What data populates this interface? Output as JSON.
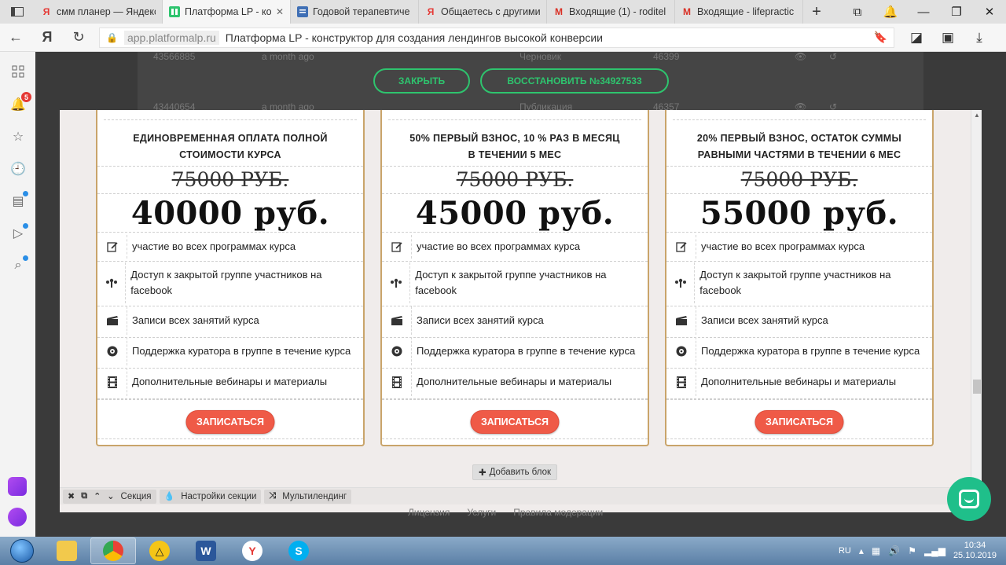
{
  "browser": {
    "tabs": [
      {
        "title": "смм планер — Яндекс",
        "favicon": "yandex-icon",
        "active": false
      },
      {
        "title": "Платформа LP - кон",
        "favicon": "platformalp-icon",
        "active": true
      },
      {
        "title": "Годовой терапевтиче",
        "favicon": "document-icon",
        "active": false
      },
      {
        "title": "Общаетесь с другими",
        "favicon": "yandex-icon",
        "active": false
      },
      {
        "title": "Входящие (1) - roditel",
        "favicon": "gmail-icon",
        "active": false
      },
      {
        "title": "Входящие - lifepractic",
        "favicon": "gmail-icon",
        "active": false
      }
    ],
    "new_tab": "+",
    "address": {
      "host": "app.platformalp.ru",
      "page_title": "Платформа LP - конструктор для создания лендингов высокой конверсии"
    },
    "nav_yandex": "Я"
  },
  "sidebar": {
    "notification_count": "5"
  },
  "background_table": {
    "rows": [
      {
        "id": "43566885",
        "time": "a month ago",
        "status": "Черновик",
        "num": "46399"
      },
      {
        "id": "43440654",
        "time": "a month ago",
        "status": "Публикация",
        "num": "46357"
      }
    ]
  },
  "actions": {
    "close_label": "ЗАКРЫТЬ",
    "restore_label": "ВОССТАНОВИТЬ №34927533"
  },
  "pricing": {
    "cards": [
      {
        "name": "ЕДИНОВРЕМЕННАЯ ОПЛАТА ПОЛНОЙ СТОИМОСТИ КУРСА",
        "old_price": "75000 РУБ.",
        "price": "40000 руб.",
        "cta": "ЗАПИСАТЬСЯ"
      },
      {
        "name": "50% ПЕРВЫЙ ВЗНОС, 10 % РАЗ В МЕСЯЦ В ТЕЧЕНИИ 5 МЕС",
        "old_price": "75000 РУБ.",
        "price": "45000 руб.",
        "cta": "ЗАПИСАТЬСЯ"
      },
      {
        "name": "20% ПЕРВЫЙ ВЗНОС, ОСТАТОК СУММЫ РАВНЫМИ ЧАСТЯМИ В ТЕЧЕНИИ 6 МЕС",
        "old_price": "75000 РУБ.",
        "price": "55000 руб.",
        "cta": "ЗАПИСАТЬСЯ"
      }
    ],
    "features": [
      {
        "icon": "edit-icon",
        "text": "участие во всех программах курса"
      },
      {
        "icon": "network-icon",
        "text": "Доступ к закрытой группе участников на facebook"
      },
      {
        "icon": "clapperboard-icon",
        "text": "Записи всех занятий курса"
      },
      {
        "icon": "support-icon",
        "text": "Поддержка куратора в группе в течение курса"
      },
      {
        "icon": "film-icon",
        "text": "Дополнительные вебинары и материалы"
      }
    ]
  },
  "editor": {
    "add_block": "Добавить блок",
    "section_label": "Секция",
    "section_settings": "Настройки секции",
    "multilanding": "Мультилендинг"
  },
  "footer_links": [
    "Лицензия",
    "Услуги",
    "Правила модерации"
  ],
  "taskbar": {
    "lang": "RU",
    "time": "10:34",
    "date": "25.10.2019"
  },
  "colors": {
    "accent_green": "#2ec46e",
    "cta_red": "#ef5a47",
    "card_border": "#c9a46a",
    "chat_green": "#1fbf8a"
  }
}
